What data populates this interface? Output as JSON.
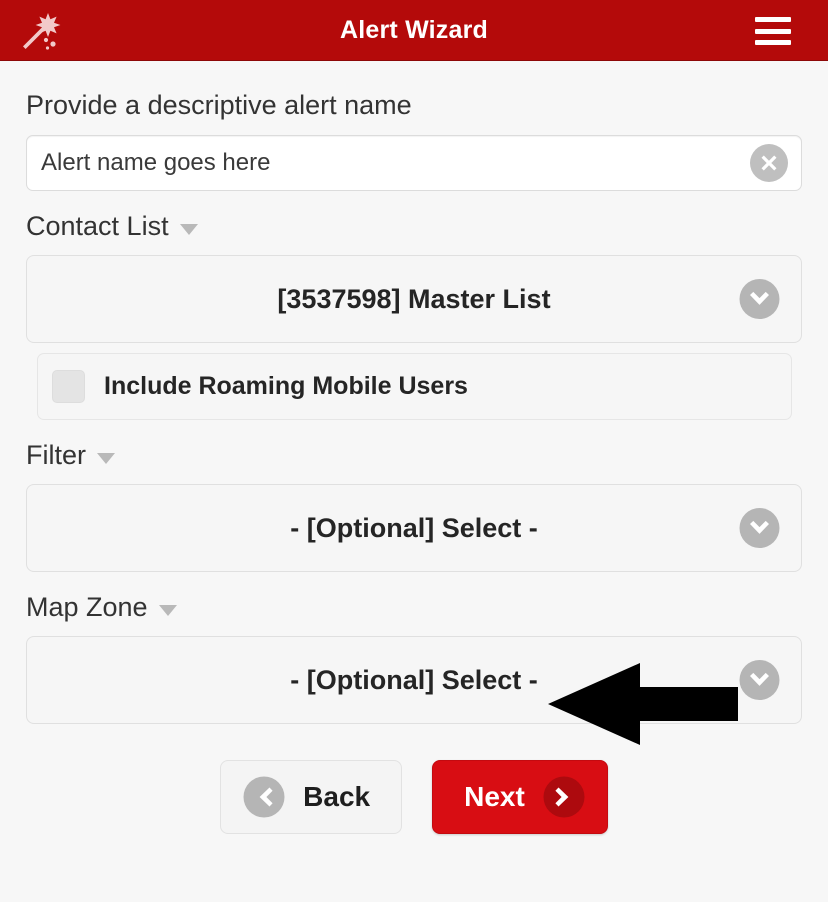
{
  "header": {
    "title": "Alert Wizard",
    "wand_icon": "magic-wand-icon",
    "menu_icon": "hamburger-menu-icon",
    "background_color": "#b40a0a"
  },
  "form": {
    "alert_name": {
      "label": "Provide a descriptive alert name",
      "value": "Alert name goes here",
      "placeholder": "Alert name goes here",
      "clear_icon": "clear-circle-x-icon"
    },
    "contact_list": {
      "label": "Contact List",
      "caret_icon": "triangle-down-icon",
      "selected": "[3537598] Master List",
      "chevron_icon": "chevron-down-circle-icon"
    },
    "roaming": {
      "label": "Include Roaming Mobile Users",
      "checked": false
    },
    "filter": {
      "label": "Filter",
      "caret_icon": "triangle-down-icon",
      "selected": "- [Optional] Select -",
      "chevron_icon": "chevron-down-circle-icon"
    },
    "map_zone": {
      "label": "Map Zone",
      "caret_icon": "triangle-down-icon",
      "selected": "- [Optional] Select -",
      "chevron_icon": "chevron-down-circle-icon"
    }
  },
  "annotation": {
    "arrow_icon": "left-pointing-arrow-annotation",
    "color": "#000000",
    "points_at": "map_zone"
  },
  "footer": {
    "back": {
      "label": "Back",
      "icon": "chevron-left-circle-icon"
    },
    "next": {
      "label": "Next",
      "icon": "chevron-right-circle-icon",
      "color": "#d80d13"
    }
  }
}
